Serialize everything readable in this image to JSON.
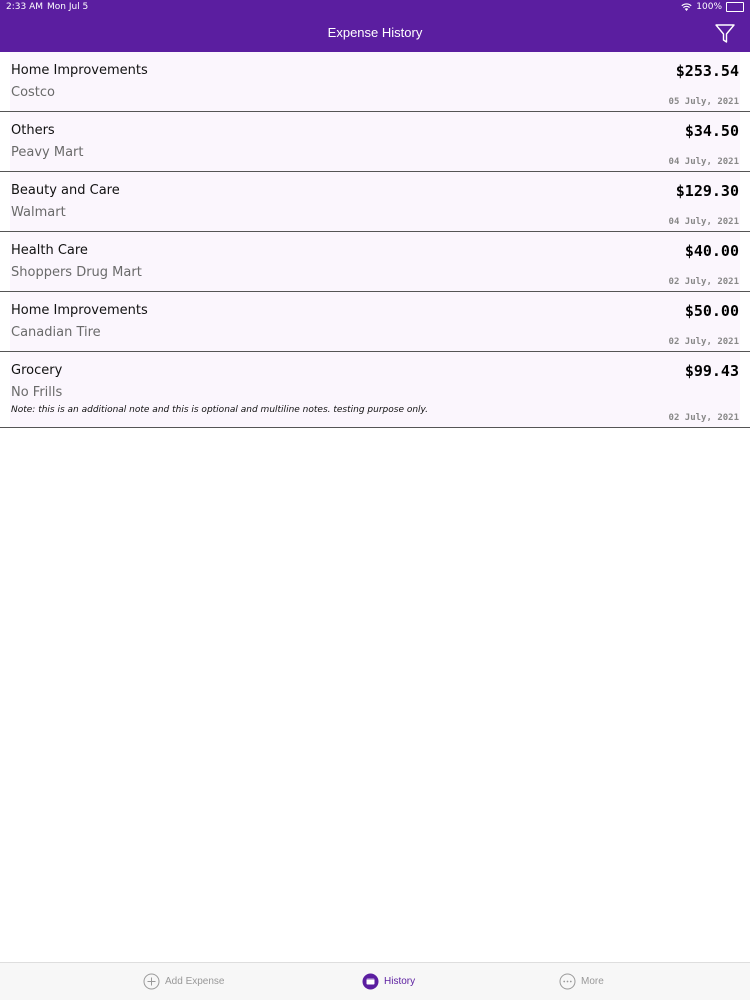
{
  "status_bar": {
    "time": "2:33 AM",
    "date": "Mon Jul 5",
    "battery": "100%"
  },
  "header": {
    "title": "Expense History",
    "filter_icon": "filter-icon"
  },
  "expenses": [
    {
      "category": "Home Improvements",
      "store": "Costco",
      "amount": "$253.54",
      "date": "05 July, 2021"
    },
    {
      "category": "Others",
      "store": "Peavy Mart",
      "amount": "$34.50",
      "date": "04 July, 2021"
    },
    {
      "category": "Beauty and Care",
      "store": "Walmart",
      "amount": "$129.30",
      "date": "04 July, 2021"
    },
    {
      "category": "Health Care",
      "store": "Shoppers Drug Mart",
      "amount": "$40.00",
      "date": "02 July, 2021"
    },
    {
      "category": "Home Improvements",
      "store": "Canadian Tire",
      "amount": "$50.00",
      "date": "02 July, 2021"
    },
    {
      "category": "Grocery",
      "store": "No Frills",
      "amount": "$99.43",
      "date": "02 July, 2021",
      "note": "Note: this is an additional note and this is optional and multiline notes. testing purpose only."
    }
  ],
  "tab_bar": {
    "tabs": [
      {
        "label": "Add Expense",
        "icon": "add-circle-icon",
        "active": false
      },
      {
        "label": "History",
        "icon": "history-icon",
        "active": true
      },
      {
        "label": "More",
        "icon": "more-icon",
        "active": false
      }
    ]
  },
  "colors": {
    "accent": "#5b1ea0",
    "row_background": "#fbf6fd",
    "inactive_tab": "#999999"
  }
}
